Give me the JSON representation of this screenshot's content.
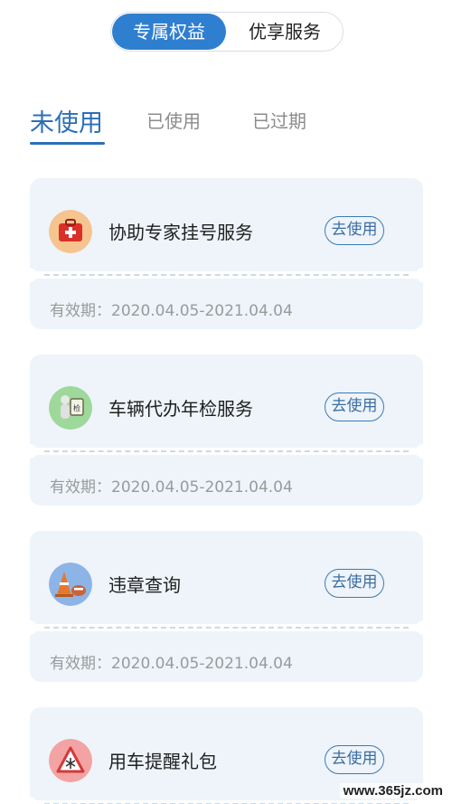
{
  "segment": {
    "active": "专属权益",
    "inactive": "优享服务"
  },
  "tabs": {
    "unused": "未使用",
    "used": "已使用",
    "expired": "已过期"
  },
  "cards": [
    {
      "title": "协助专家挂号服务",
      "button": "去使用",
      "validity": "有效期：2020.04.05-2021.04.04",
      "icon": "medical-kit-icon"
    },
    {
      "title": "车辆代办年检服务",
      "button": "去使用",
      "validity": "有效期：2020.04.05-2021.04.04",
      "icon": "inspection-person-icon"
    },
    {
      "title": "违章查询",
      "button": "去使用",
      "validity": "有效期：2020.04.05-2021.04.04",
      "icon": "traffic-cone-icon"
    },
    {
      "title": "用车提醒礼包",
      "button": "去使用",
      "validity": "",
      "icon": "snow-warning-icon"
    }
  ],
  "watermark": "www.365jz.com",
  "colors": {
    "accent": "#2f7fd0",
    "tab_active": "#2c6fb7",
    "card_bg": "#eef4fa"
  }
}
